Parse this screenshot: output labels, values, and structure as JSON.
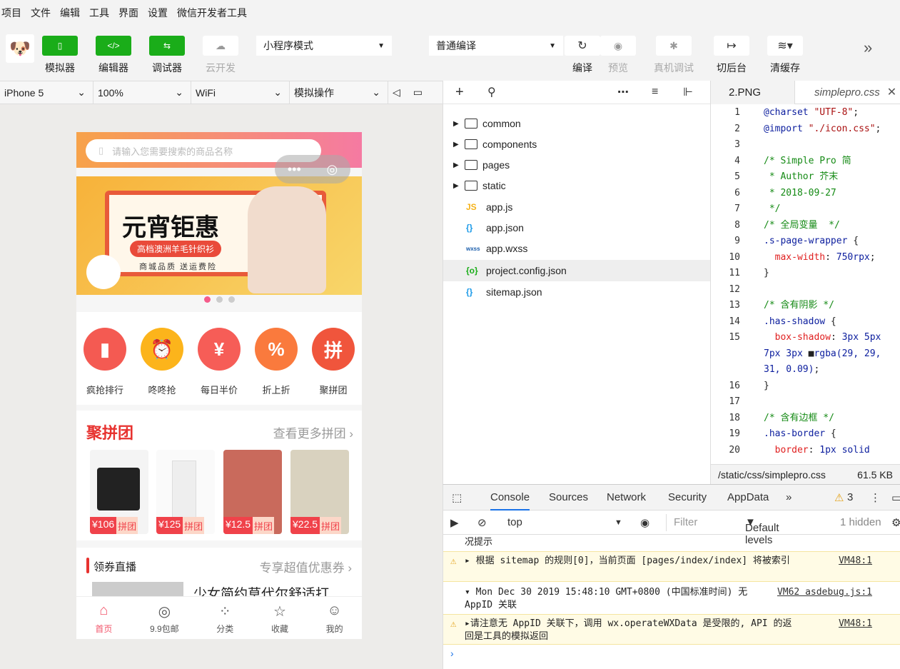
{
  "menu": [
    "项目",
    "文件",
    "编辑",
    "工具",
    "界面",
    "设置",
    "微信开发者工具"
  ],
  "toolbar": {
    "simulator": "模拟器",
    "editor": "编辑器",
    "debugger": "调试器",
    "cloud": "云开发",
    "mode_select": "小程序模式",
    "compile_select": "普通编译",
    "compile": "编译",
    "preview": "预览",
    "remote_debug": "真机调试",
    "background": "切后台",
    "clear_cache": "清缓存",
    "expand_icon": "»"
  },
  "simbar": {
    "device": "iPhone 5",
    "zoom": "100%",
    "network": "WiFi",
    "operation": "模拟操作"
  },
  "phone": {
    "search_placeholder": "请输入您需要搜索的商品名称",
    "banner_title": "元宵钜惠",
    "banner_sub": "高档澳洲羊毛针织衫",
    "banner_sub2": "商城品质 送运费险",
    "categories": [
      "疯抢排行",
      "咚咚抢",
      "每日半价",
      "折上折",
      "聚拼团"
    ],
    "group_title": "聚拼团",
    "group_more": "查看更多拼团",
    "group_items": [
      {
        "price": "¥106",
        "tag": "拼团"
      },
      {
        "price": "¥125",
        "tag": "拼团"
      },
      {
        "price": "¥12.5",
        "tag": "拼团"
      },
      {
        "price": "¥22.5",
        "tag": "拼团"
      }
    ],
    "live_title": "领券直播",
    "live_more": "专享超值优惠券",
    "live_item": "少女简约草代尔舒适打",
    "tabs": [
      "首页",
      "9.9包邮",
      "分类",
      "收藏",
      "我的"
    ]
  },
  "explorer": {
    "folders": [
      "common",
      "components",
      "pages",
      "static"
    ],
    "files": [
      {
        "ext": "JS",
        "name": "app.js"
      },
      {
        "ext": "{}",
        "name": "app.json"
      },
      {
        "ext": "wxss",
        "name": "app.wxss"
      },
      {
        "ext": "{o}",
        "name": "project.config.json"
      },
      {
        "ext": "{}",
        "name": "sitemap.json"
      }
    ]
  },
  "editor": {
    "tab1": "2.PNG",
    "tab2": "simplepro.css",
    "status_path": "/static/css/simplepro.css",
    "status_size": "61.5 KB"
  },
  "devtools": {
    "tabs": [
      "Console",
      "Sources",
      "Network",
      "Security",
      "AppData"
    ],
    "warn_count": "3",
    "context": "top",
    "filter_placeholder": "Filter",
    "levels": "Default levels",
    "hidden": "1 hidden",
    "messages": [
      {
        "text": "况提示",
        "src": ""
      },
      {
        "text": "▸ 根据 sitemap 的规则[0]，当前页面 [pages/index/index] 将被索引",
        "src": "VM48:1"
      },
      {
        "text": "▾ Mon Dec 30 2019 15:48:10 GMT+0800 (中国标准时间) 无 AppID 关联",
        "src": "VM62 asdebug.js:1"
      },
      {
        "text": "▸请注意无 AppID 关联下，调用 wx.operateWXData 是受限的, API 的返回是工具的模拟返回",
        "src": "VM48:1"
      }
    ]
  }
}
